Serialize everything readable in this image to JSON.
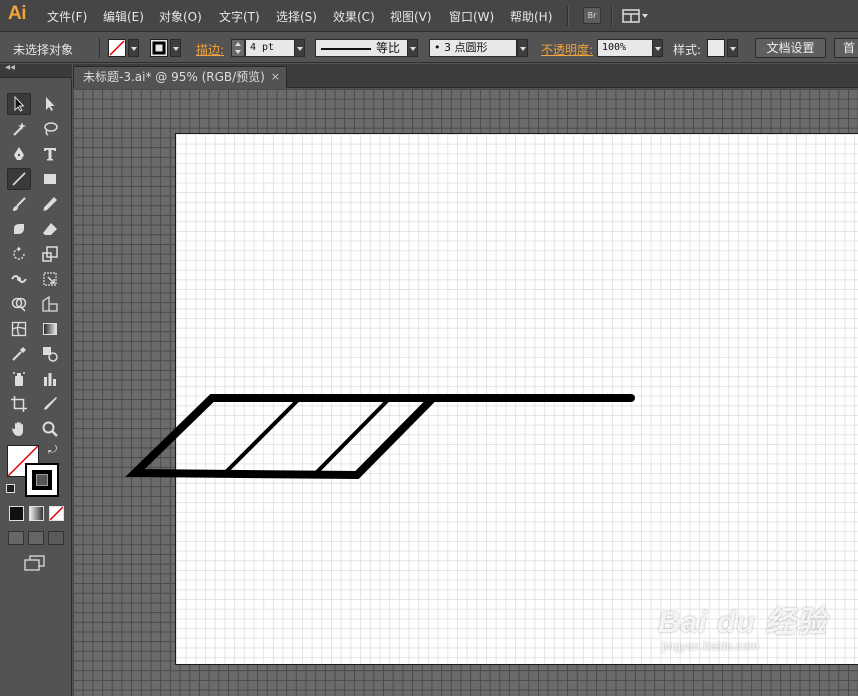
{
  "app": {
    "logo": "Ai",
    "menu": [
      "文件(F)",
      "编辑(E)",
      "对象(O)",
      "文字(T)",
      "选择(S)",
      "效果(C)",
      "视图(V)",
      "窗口(W)",
      "帮助(H)"
    ],
    "bridge_label": "Br"
  },
  "control_bar": {
    "selection_status": "未选择对象",
    "stroke_label": "描边:",
    "stroke_weight": "4 pt",
    "profile_label": "等比",
    "brush_value": "• 3 点圆形",
    "opacity_label": "不透明度:",
    "opacity_value": "100%",
    "style_label": "样式:",
    "doc_setup_button": "文档设置",
    "first_button": "首"
  },
  "document": {
    "tab_title": "未标题-3.ai* @ 95% (RGB/预览)",
    "close_glyph": "×",
    "zoom": "95%",
    "color_mode": "RGB/预览"
  },
  "toolbox": {
    "collapse_glyph": "◂◂",
    "active_tool": "line-segment-tool"
  },
  "watermark": {
    "brand": "Bai du 经验",
    "url": "jingyan.baidu.com"
  },
  "colors": {
    "accent_orange": "#f2a33a",
    "canvas_bg": "#6b6b6b",
    "artboard_bg": "#ffffff",
    "stroke": "#000000"
  }
}
